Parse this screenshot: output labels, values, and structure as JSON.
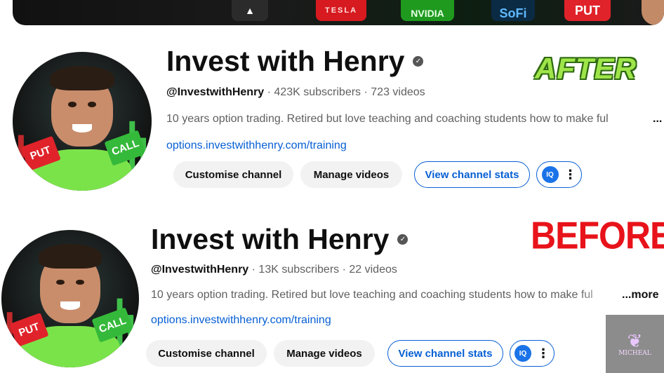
{
  "banner": {
    "logos": [
      "robinhood-logo",
      "tesla-logo",
      "nvidia-logo",
      "sofi-logo",
      "put-logo"
    ],
    "tesla_text": "TESLA",
    "nvidia_text": "NVIDIA",
    "sofi_text": "SoFi",
    "put_text": "PUT"
  },
  "labels": {
    "after": "AFTER",
    "before": "BEFORE"
  },
  "after": {
    "channel_name": "Invest with Henry",
    "handle": "@InvestwithHenry",
    "subscribers": "423K subscribers",
    "videos": "723 videos",
    "description": "10 years option trading. Retired but love teaching and coaching students how to make ful",
    "more": "...",
    "link": "options.investwithhenry.com/training",
    "buttons": {
      "customise": "Customise channel",
      "manage": "Manage videos",
      "stats": "View channel stats"
    },
    "avatar_tags": {
      "put": "PUT",
      "call": "CALL"
    }
  },
  "before": {
    "channel_name": "Invest with Henry",
    "handle": "@InvestwithHenry",
    "subscribers": "13K subscribers",
    "videos": "22 videos",
    "description": "10 years option trading. Retired but love teaching and coaching students how to make ful",
    "more": "...more",
    "link": "options.investwithhenry.com/training",
    "buttons": {
      "customise": "Customise channel",
      "manage": "Manage videos",
      "stats": "View channel stats"
    },
    "avatar_tags": {
      "put": "PUT",
      "call": "CALL"
    }
  },
  "meta_separator": "·",
  "extension_icon_text": "IQ",
  "watermark": {
    "text": "MICHEAL"
  },
  "colors": {
    "after_label": "#9fe54a",
    "before_label": "#e8131a",
    "link": "#065fd4",
    "button_grey": "#f2f2f2"
  }
}
